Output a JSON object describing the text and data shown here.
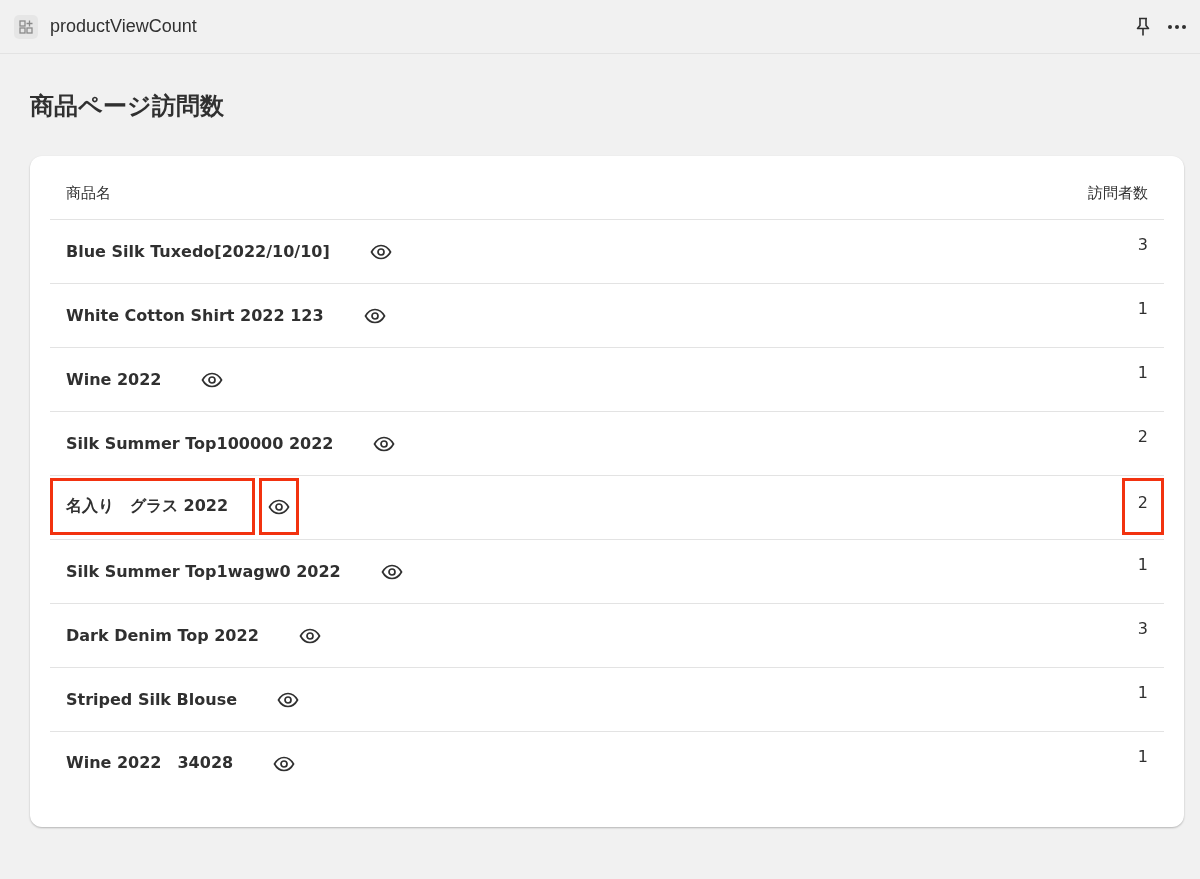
{
  "app_bar": {
    "title": "productViewCount"
  },
  "page_title": "商品ページ訪問数",
  "table": {
    "columns": [
      "商品名",
      "訪問者数"
    ],
    "rows": [
      {
        "name": "Blue Silk Tuxedo[2022/10/10]",
        "visitors": "3",
        "highlighted": false
      },
      {
        "name": "White Cotton Shirt 2022 123",
        "visitors": "1",
        "highlighted": false
      },
      {
        "name": "Wine 2022",
        "visitors": "1",
        "highlighted": false
      },
      {
        "name": "Silk Summer Top100000 2022",
        "visitors": "2",
        "highlighted": false
      },
      {
        "name": "名入り　グラス 2022",
        "visitors": "2",
        "highlighted": true
      },
      {
        "name": "Silk Summer Top1wagw0 2022",
        "visitors": "1",
        "highlighted": false
      },
      {
        "name": "Dark Denim Top 2022",
        "visitors": "3",
        "highlighted": false
      },
      {
        "name": "Striped Silk Blouse",
        "visitors": "1",
        "highlighted": false
      },
      {
        "name": "Wine 2022　34028",
        "visitors": "1",
        "highlighted": false
      }
    ]
  }
}
